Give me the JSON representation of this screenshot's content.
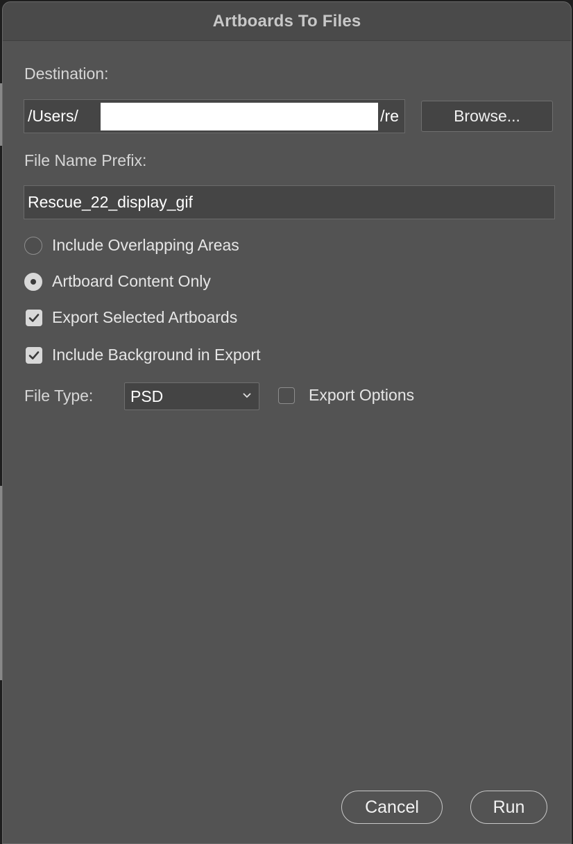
{
  "window": {
    "title": "Artboards To Files"
  },
  "destination": {
    "label": "Destination:",
    "value_prefix": "/Users/",
    "value_suffix": "/re",
    "browse_label": "Browse..."
  },
  "prefix": {
    "label": "File Name Prefix:",
    "value": "Rescue_22_display_gif"
  },
  "options": [
    {
      "label": "Include Overlapping Areas",
      "type": "radio",
      "checked": false
    },
    {
      "label": "Artboard Content Only",
      "type": "radio",
      "checked": true
    },
    {
      "label": "Export Selected Artboards",
      "type": "checkbox",
      "checked": true
    },
    {
      "label": "Include Background in Export",
      "type": "checkbox",
      "checked": true
    }
  ],
  "file_type": {
    "label": "File Type:",
    "selected": "PSD",
    "export_options_label": "Export Options",
    "export_options_checked": false
  },
  "footer": {
    "cancel_label": "Cancel",
    "run_label": "Run"
  },
  "icons": {
    "radio": "radio-icon",
    "checkbox": "checkbox-icon",
    "checkmark": "checkmark-icon",
    "chevron": "chevron-down-icon"
  },
  "colors": {
    "panel": "#535353",
    "field": "#454545",
    "text": "#d6d6d6"
  }
}
